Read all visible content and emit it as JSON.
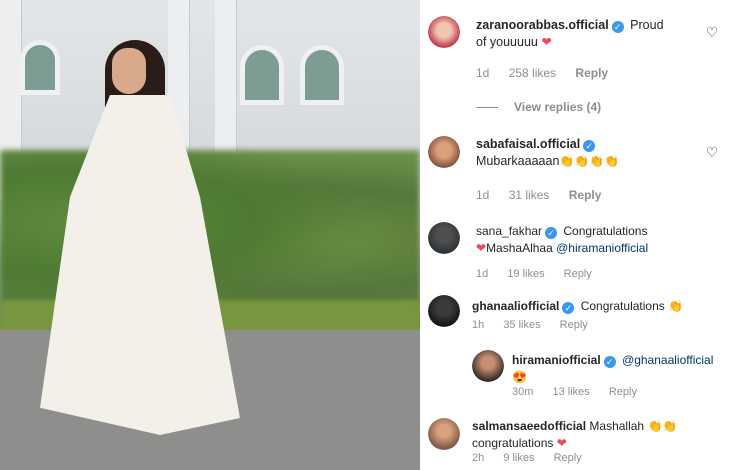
{
  "post": {
    "image_alt": "woman in white dress photo"
  },
  "comments": [
    {
      "user": "zaranoorabbas.official",
      "verified": true,
      "text_1": "Proud",
      "text_2": "of youuuuu",
      "emoji": "❤",
      "time": "1d",
      "likes": "258 likes",
      "reply": "Reply",
      "view_replies": "View replies (4)"
    },
    {
      "user": "sabafaisal.official",
      "verified": true,
      "text_1": "Mubarkaaaaan",
      "emoji": "👏👏👏👏",
      "time": "1d",
      "likes": "31 likes",
      "reply": "Reply"
    },
    {
      "user": "sana_fakhar",
      "verified": true,
      "text_1": "Congratulations",
      "emoji": "❤",
      "text_2": "MashaAlhaa",
      "mention": "@hiramaniofficial",
      "time": "1d",
      "likes": "19 likes",
      "reply": "Reply"
    },
    {
      "user": "ghanaaliofficial",
      "verified": true,
      "text_1": "Congratulations",
      "emoji": "👏",
      "time": "1h",
      "likes": "35 likes",
      "reply": "Reply"
    },
    {
      "user": "hiramaniofficial",
      "verified": true,
      "mention": "@ghanaaliofficial",
      "emoji": "😍",
      "time": "30m",
      "likes": "13 likes",
      "reply": "Reply"
    },
    {
      "user": "salmansaeedofficial",
      "verified": false,
      "text_1": "Mashallah",
      "emoji_1": "👏👏",
      "text_2": "congratulations",
      "emoji_2": "❤",
      "time": "2h",
      "likes": "9 likes",
      "reply": "Reply"
    }
  ],
  "colors": {
    "verified": "#3897f0",
    "heart": "#ed4956",
    "muted": "#8e8e8e",
    "mention": "#00376b"
  },
  "icons": {
    "like": "heart-outline-icon",
    "verified": "verified-badge-icon"
  }
}
